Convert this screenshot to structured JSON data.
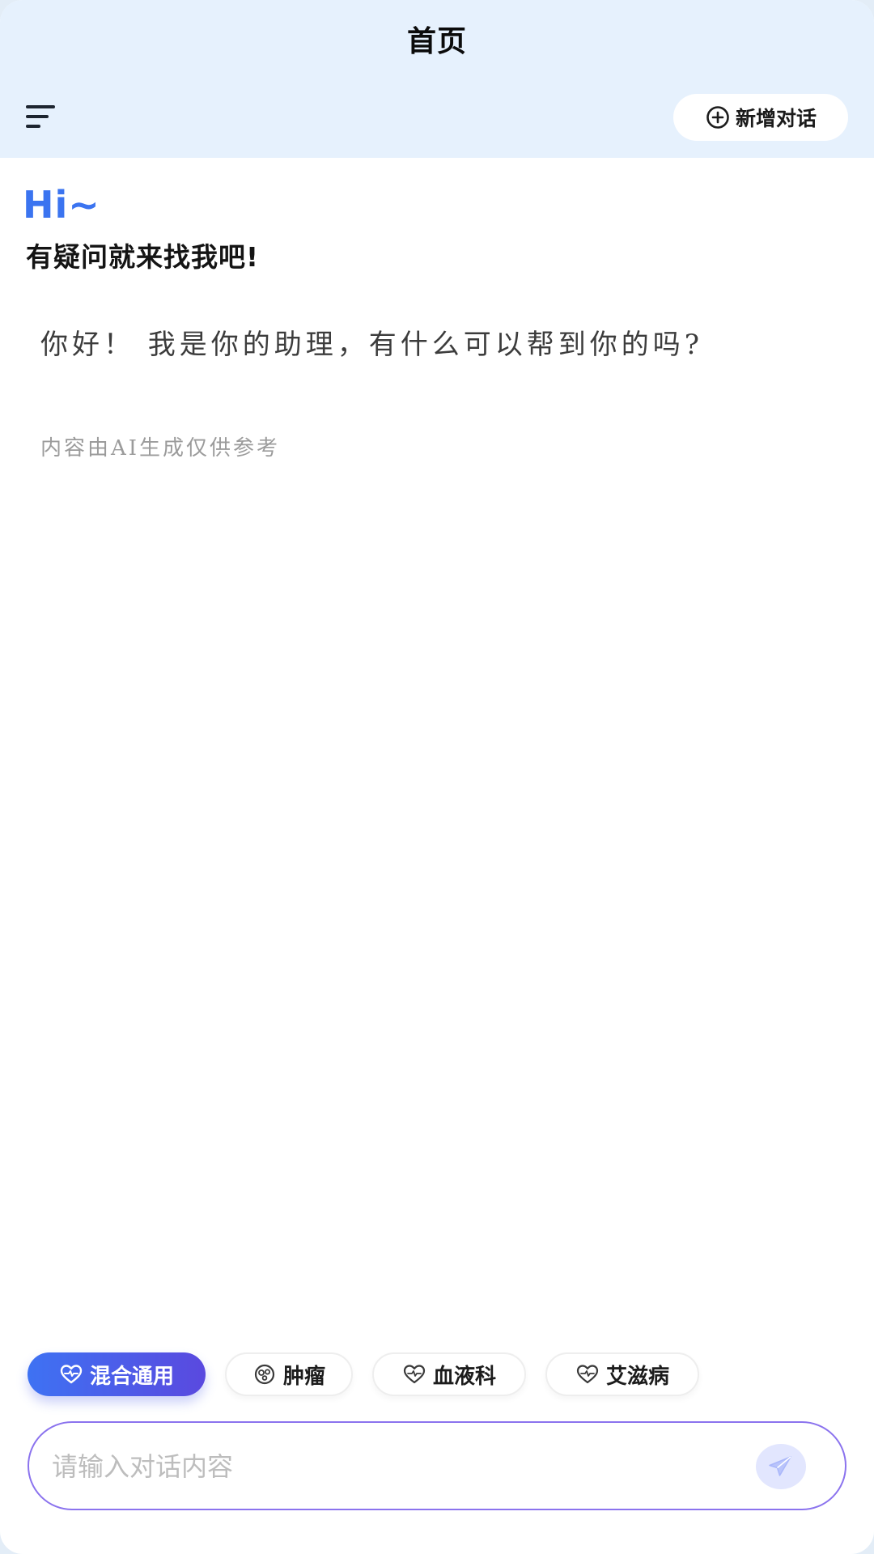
{
  "header": {
    "title": "首页",
    "menu_icon": "menu-lines-icon",
    "new_chat": {
      "icon": "plus-circle-icon",
      "label": "新增对话"
    }
  },
  "welcome": {
    "hi": "Hi~",
    "subtitle": "有疑问就来找我吧!"
  },
  "message": {
    "text": "你好！ 我是你的助理，有什么可以帮到你的吗?",
    "disclaimer": "内容由AI生成仅供参考"
  },
  "modes": [
    {
      "label": "混合通用",
      "icon": "heart-pulse-icon",
      "active": true
    },
    {
      "label": "肿瘤",
      "icon": "tumor-icon",
      "active": false
    },
    {
      "label": "血液科",
      "icon": "heart-pulse-icon",
      "active": false
    },
    {
      "label": "艾滋病",
      "icon": "heart-pulse-icon",
      "active": false
    }
  ],
  "composer": {
    "placeholder": "请输入对话内容",
    "send_icon": "send-plane-icon"
  },
  "colors": {
    "header_bg": "#e6f1fd",
    "accent_blue": "#3b74f0",
    "accent_purple": "#5a49df",
    "input_border": "#8b73ee"
  }
}
